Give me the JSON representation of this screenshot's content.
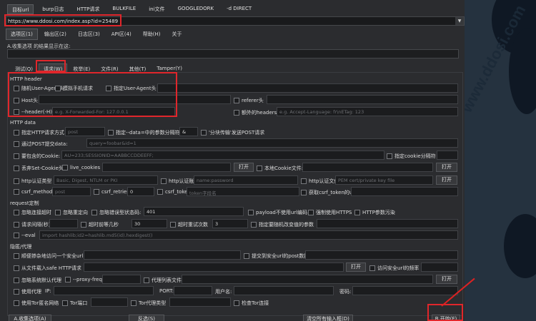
{
  "menubar": [
    "目标url",
    "burp日志",
    "HTTP请求",
    "BULKFILE",
    "ini文件",
    "GOOGLEDORK",
    "-d DIRECT"
  ],
  "url": {
    "value": "https://www.ddosi.com/index.asp?id=25489"
  },
  "tabs1": [
    "选项区(1)",
    "输出区(2)",
    "日志区(3)",
    "API区(4)",
    "帮助(H)",
    "关于"
  ],
  "collect_label": "A.收集选项 的结果显示在这:",
  "tabs2": [
    "测试(Q)",
    "请求(W)",
    "枚举(E)",
    "文件(R)",
    "其他(T)",
    "Tamper(Y)"
  ],
  "header_section": {
    "title": "HTTP header",
    "random_ua": "随机User-Agent头",
    "mobile": "模拟手机请求",
    "custom_ua": "指定User-Agent头",
    "host": "Host头",
    "referer": "referer头",
    "header_opt": "--header(-H)",
    "header_ph": "e.g. X-Forwarded-For: 127.0.0.1",
    "extra_headers": "额外的headers",
    "extra_ph": "e.g. Accept-Language: fr\\nETag: 123"
  },
  "data_section": {
    "title": "HTTP data",
    "method": "指定HTTP请求方式",
    "method_ph": "post",
    "data_sep": "指定--data=中的参数分隔符",
    "data_sep_val": "&",
    "chunked": "'分块传输'发送POST请求",
    "post_data": "通过POST提交data:",
    "post_ph": "query=foobar&id=1",
    "cookie": "要包含的Cookie:",
    "cookie_ph": "AU=233;SESSIONID=AABBCCDDEEFF;",
    "cookie_sep": "指定cookie分隔符",
    "set_cookie": "丢弃Set-Cookie头",
    "live_cookies": "live_cookies",
    "open": "打开",
    "local_cookie": "本地Cookie文件:",
    "auth_type": "http认证类型",
    "auth_type_ph": "Basic, Digest, NTLM or PKI",
    "auth_cred": "http认证账密",
    "auth_cred_ph": "name:password",
    "auth_file": "http认证文件",
    "auth_file_ph": "PEM cert/private key file",
    "csrf_method": "csrf_method",
    "csrf_method_ph": "post",
    "csrf_retries": "csrf_retries",
    "csrf_retries_val": "0",
    "csrf_token": "csrf_token",
    "csrf_token_ph": "token字段名",
    "csrf_url": "获取csrf_token的url"
  },
  "request_section": {
    "title": "request定制",
    "ignore_timeout": "忽略连接超时",
    "ignore_redirect": "忽略重定向",
    "ignore_code": "忽略错误型状态码:",
    "ignore_code_val": "401",
    "payload_no_encode": "payload不使用url编码",
    "force_https": "强制使用HTTPS",
    "http_pollution": "HTTP参数污染",
    "delay": "请求间隔(秒)",
    "timeout": "超时前等几秒",
    "timeout_val": "30",
    "retries": "超时重试次数",
    "retries_val": "3",
    "randomize": "指定要随机改变值的参数",
    "eval": "--eval",
    "eval_ph": "import hashlib;id2=hashlib.md5(id).hexdigest()"
  },
  "hide_section": {
    "title": "隐匿/代理",
    "safe_url": "顺便掺杂地访问一个安全url",
    "safe_post": "提交到安全url的post数据",
    "safe_req_file": "从文件载入safe HTTP请求",
    "open": "打开",
    "safe_freq": "访问安全url的频率",
    "ignore_proxy": "忽略系统默认代理",
    "proxy_freq": "--proxy-freq",
    "proxy_file": "代理列表文件",
    "use_proxy": "使用代理",
    "ip": "IP:",
    "port": "PORT:",
    "user": "用户名:",
    "pass": "密码:",
    "tor": "使用Tor匿名网络",
    "tor_port": "Tor端口",
    "tor_type": "Tor代理类型",
    "check_tor": "检查Tor连接"
  },
  "bottom": {
    "collect": "A.收集选项(A)",
    "clear": "反选(S)",
    "clear_input": "清空所有输入框(D)",
    "start": "B.开始(F)"
  },
  "watermark": "www.ddosi.com",
  "colors": {
    "highlight": "#e0262b",
    "bg": "#2b2c2f"
  }
}
